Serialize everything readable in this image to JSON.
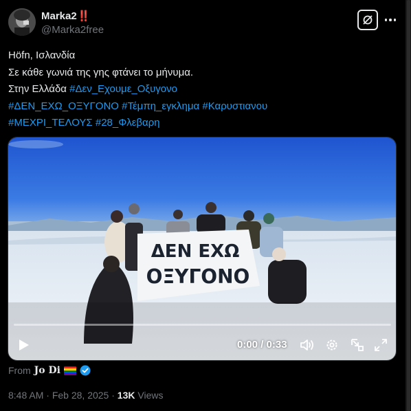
{
  "author": {
    "display_name": "Marka2",
    "name_emoji": "‼️",
    "handle": "@Marka2free"
  },
  "post": {
    "line1": "Höfn, Ισλανδία",
    "line2": "Σε κάθε γωνιά της γης φτάνει το μήνυμα.",
    "line3_text": "Στην Ελλάδα ",
    "line3_tag": "#Δεν_Εχουμε_Οξυγονο",
    "tags_row1": [
      "#ΔΕΝ_ΕΧΩ_ΟΞΥΓΟΝΟ",
      "#Τέμπη_εγκλημα",
      "#Καρυστιανου"
    ],
    "tags_row2": [
      "#ΜΕΧΡΙ_ΤΕΛΟΥΣ",
      "#28_Φλεβαρη"
    ]
  },
  "media": {
    "banner_line1": "ΔΕΝ ΕΧΩ",
    "banner_line2": "ΟΞΥΓΟΝΟ",
    "time_display": "0:00 / 0:33",
    "progress": 0
  },
  "attribution": {
    "from_label": "From",
    "source_name": "𝐉𝐨 𝐃𝐢"
  },
  "footer": {
    "time": "8:48 AM",
    "sep": "·",
    "date": "Feb 28, 2025",
    "views_count": "13K",
    "views_label": "Views"
  },
  "icons": {
    "grok": "grok-icon",
    "more": "more-icon",
    "play": "play-icon",
    "volume": "volume-icon",
    "settings": "settings-icon",
    "pip": "pip-icon",
    "fullscreen": "fullscreen-icon",
    "verified": "verified-badge-icon"
  },
  "colors": {
    "background": "#000000",
    "text": "#e7e9ea",
    "muted": "#71767b",
    "link": "#1d9bf0"
  }
}
